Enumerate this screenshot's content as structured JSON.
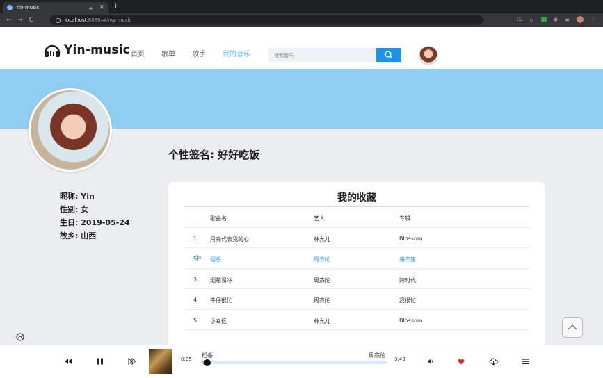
{
  "browser": {
    "tab_title": "Yin-music",
    "tab_extra": "🔈",
    "url_host": "localhost",
    "url_path": ":8080/#/my-music"
  },
  "header": {
    "logo_text": "Yin-music",
    "nav": [
      "首页",
      "歌单",
      "歌手",
      "我的音乐"
    ],
    "active_nav": 3,
    "search_placeholder": "搜索音乐"
  },
  "profile": {
    "signature": "个性签名: 好好吃饭",
    "info": [
      {
        "label": "昵称:",
        "value": "Yin"
      },
      {
        "label": "性别:",
        "value": "女"
      },
      {
        "label": "生日:",
        "value": "2019-05-24"
      },
      {
        "label": "故乡:",
        "value": "山西"
      }
    ]
  },
  "collection": {
    "title": "我的收藏",
    "columns": {
      "name": "歌曲名",
      "artist": "艺人",
      "album": "专辑"
    },
    "rows": [
      {
        "idx": "1",
        "name": "月亮代表我的心",
        "artist": "林允儿",
        "album": "Blossom",
        "playing": false
      },
      {
        "idx": "",
        "name": "稻香",
        "artist": "周杰伦",
        "album": "魔杰座",
        "playing": true
      },
      {
        "idx": "3",
        "name": "烟花易冷",
        "artist": "周杰伦",
        "album": "跨时代",
        "playing": false
      },
      {
        "idx": "4",
        "name": "牛仔很忙",
        "artist": "周杰伦",
        "album": "我很忙",
        "playing": false
      },
      {
        "idx": "5",
        "name": "小幸运",
        "artist": "林允儿",
        "album": "Blossom",
        "playing": false
      }
    ]
  },
  "player": {
    "current_time": "0:05",
    "total_time": "3:43",
    "song": "稻香",
    "artist": "周杰伦",
    "progress": 0.02
  },
  "colors": {
    "accent": "#3a9ee4",
    "banner": "#90cdf0",
    "search_button": "#1e90e6",
    "heart": "#e8232f"
  }
}
